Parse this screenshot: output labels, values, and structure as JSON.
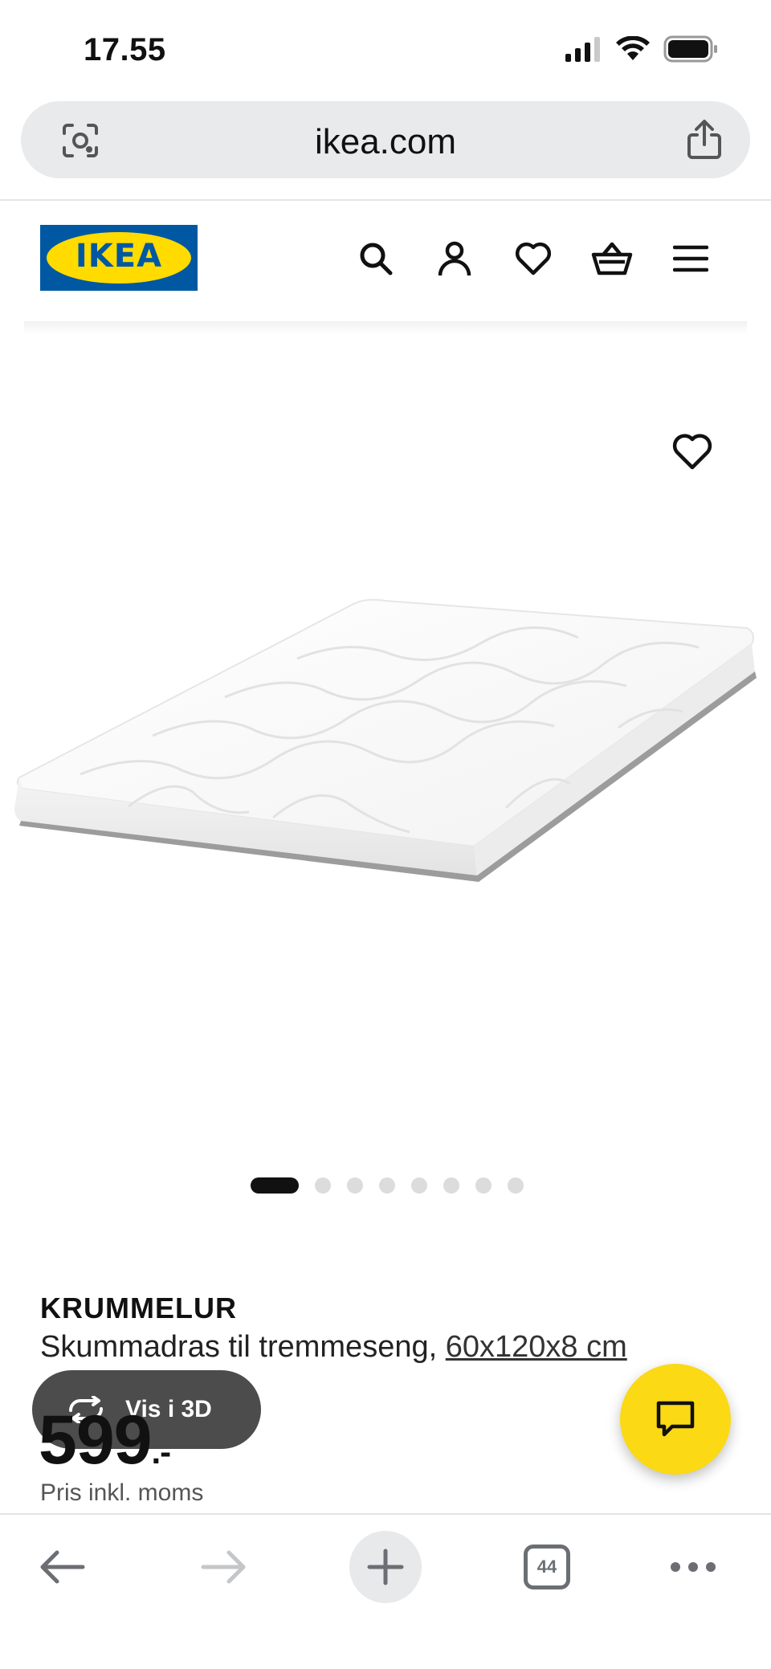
{
  "status_bar": {
    "time": "17.55"
  },
  "browser": {
    "url": "ikea.com"
  },
  "site_header": {
    "logo_text": "IKEA"
  },
  "gallery": {
    "view_3d_label": "Vis i 3D",
    "slide_count": 8,
    "active_slide": 1
  },
  "product": {
    "name": "KRUMMELUR",
    "description": "Skummadras til tremmeseng,",
    "size": "60x120x8 cm",
    "price_main": "599",
    "price_suffix": ".-",
    "price_note": "Pris inkl. moms"
  },
  "bottom_nav": {
    "tab_count": "44"
  },
  "colors": {
    "ikea_blue": "#0058a3",
    "ikea_yellow": "#ffdb00",
    "chat_yellow": "#fbd914",
    "button_dark": "#4c4c4c"
  }
}
